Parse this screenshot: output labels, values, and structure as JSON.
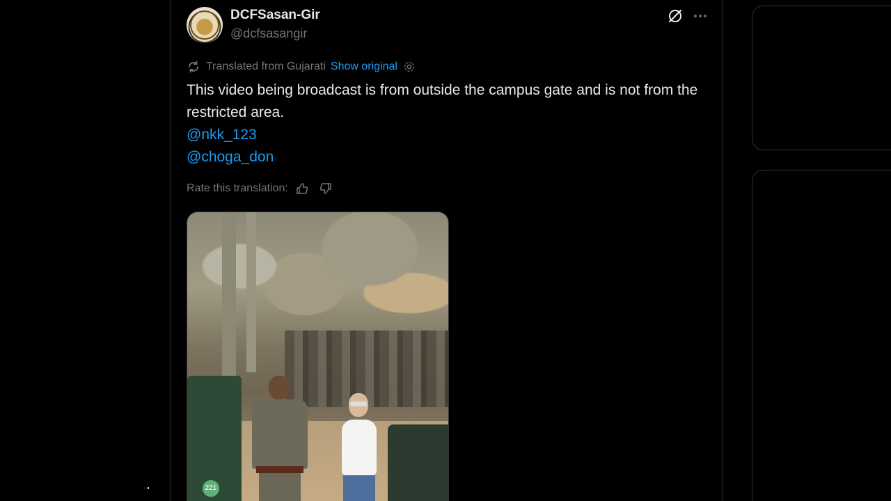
{
  "post": {
    "author_name": "DCFSasan-Gir",
    "author_handle": "@dcfsasangir",
    "translation": {
      "translated_from": "Translated from Gujarati",
      "show_original": "Show original"
    },
    "text": "This video being broadcast is from outside the campus gate and is not from the restricted area.",
    "mentions": [
      "@nkk_123",
      "@choga_don"
    ],
    "rate_label": "Rate this translation:",
    "media": {
      "vehicle_number": "221"
    }
  },
  "colors": {
    "background": "#000000",
    "text": "#e7e9ea",
    "muted": "#71767b",
    "link": "#1d9bf0",
    "border": "#2f3336"
  }
}
